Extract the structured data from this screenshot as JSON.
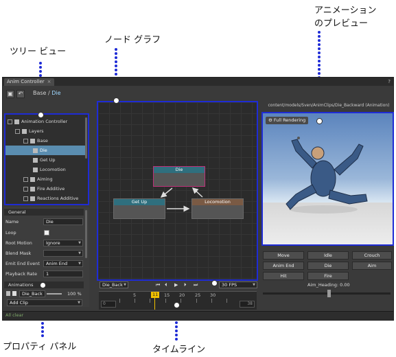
{
  "callouts": {
    "tree_view": "ツリー ビュー",
    "node_graph": "ノード グラフ",
    "animation_preview_line1": "アニメーション",
    "animation_preview_line2": "のプレビュー",
    "property_panel": "プロパティ パネル",
    "timeline": "タイムライン"
  },
  "app": {
    "tab_title": "Anim Controller",
    "tab_close": "×",
    "help": "?",
    "breadcrumb_root": "Base",
    "breadcrumb_sep": " / ",
    "breadcrumb_current": "Die",
    "status_text": "All clear"
  },
  "tree": {
    "items": [
      {
        "label": "Animation Controller"
      },
      {
        "label": "Layers"
      },
      {
        "label": "Base"
      },
      {
        "label": "Die"
      },
      {
        "label": "Get Up"
      },
      {
        "label": "Locomotion"
      },
      {
        "label": "Aiming"
      },
      {
        "label": "Fire Additive"
      },
      {
        "label": "Reactions Additive"
      }
    ]
  },
  "properties": {
    "section_general": "General",
    "name_label": "Name",
    "name_value": "Die",
    "loop_label": "Loop",
    "root_motion_label": "Root Motion",
    "root_motion_value": "Ignore",
    "blend_mask_label": "Blend Mask",
    "blend_mask_value": "",
    "emit_end_label": "Emit End Event",
    "emit_end_value": "Anim End",
    "playback_rate_label": "Playback Rate",
    "playback_rate_value": "1",
    "section_animations": "Animations",
    "anim_clip_value": "Die_Back",
    "anim_percent": "100 %",
    "add_clip_label": "Add Clip"
  },
  "graph": {
    "nodes": {
      "die": "Die",
      "get_up": "Get Up",
      "locomotion": "Locomotion"
    },
    "colors": {
      "die_header": "#2f6f7e",
      "die_border": "#c0307a",
      "getup_header": "#2f6f7e",
      "locomotion_header": "#7a5a44"
    }
  },
  "timeline": {
    "clip_select": "Die_Back",
    "fps_select": "30 FPS",
    "tick_labels": [
      "5",
      "15",
      "20",
      "25",
      "30"
    ],
    "current_frame": "11",
    "start_frame": "0",
    "end_frame": "38"
  },
  "preview": {
    "path": "content/models/Sven/AnimClips/Die_Backward (Animation)",
    "full_rendering_label": "Full Rendering",
    "gear_icon": "⚙"
  },
  "actions": {
    "buttons": [
      "Move",
      "Idle",
      "Crouch",
      "Anim End",
      "Die",
      "Aim",
      "Hit",
      "Fire"
    ],
    "heading_label": "Aim_Heading: 0.00"
  }
}
